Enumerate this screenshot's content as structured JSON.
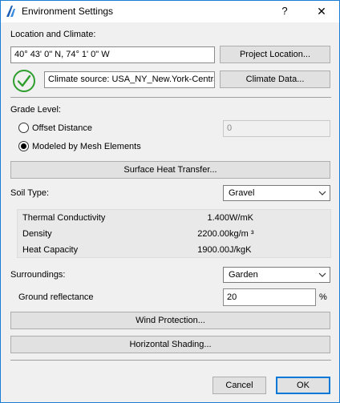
{
  "window": {
    "title": "Environment Settings",
    "help_glyph": "?",
    "close_glyph": "✕"
  },
  "location": {
    "section_label": "Location and Climate:",
    "coordinates": "40° 43' 0\" N, 74° 1' 0\" W",
    "project_location_button": "Project Location...",
    "climate_source": "Climate source: USA_NY_New.York-Central.Park",
    "climate_data_button": "Climate Data...",
    "status_icon": "checkmark-circle-icon",
    "status_color": "#2e9e2e"
  },
  "grade": {
    "section_label": "Grade Level:",
    "offset_option": "Offset Distance",
    "offset_value": "0",
    "mesh_option": "Modeled by Mesh Elements",
    "selected": "mesh",
    "surface_heat_button": "Surface Heat Transfer..."
  },
  "soil": {
    "label": "Soil Type:",
    "selected": "Gravel",
    "properties": [
      {
        "name": "Thermal Conductivity",
        "value": "1.400",
        "unit": "W/mK"
      },
      {
        "name": "Density",
        "value": "2200.00",
        "unit": "kg/m ³"
      },
      {
        "name": "Heat Capacity",
        "value": "1900.00",
        "unit": "J/kgK"
      }
    ]
  },
  "surroundings": {
    "label": "Surroundings:",
    "selected": "Garden",
    "reflectance_label": "Ground reflectance",
    "reflectance_value": "20",
    "reflectance_unit": "%",
    "wind_button": "Wind Protection...",
    "shading_button": "Horizontal Shading..."
  },
  "footer": {
    "cancel_button": "Cancel",
    "ok_button": "OK"
  },
  "colors": {
    "accent": "#0078d7",
    "border": "#1a7fd4"
  }
}
